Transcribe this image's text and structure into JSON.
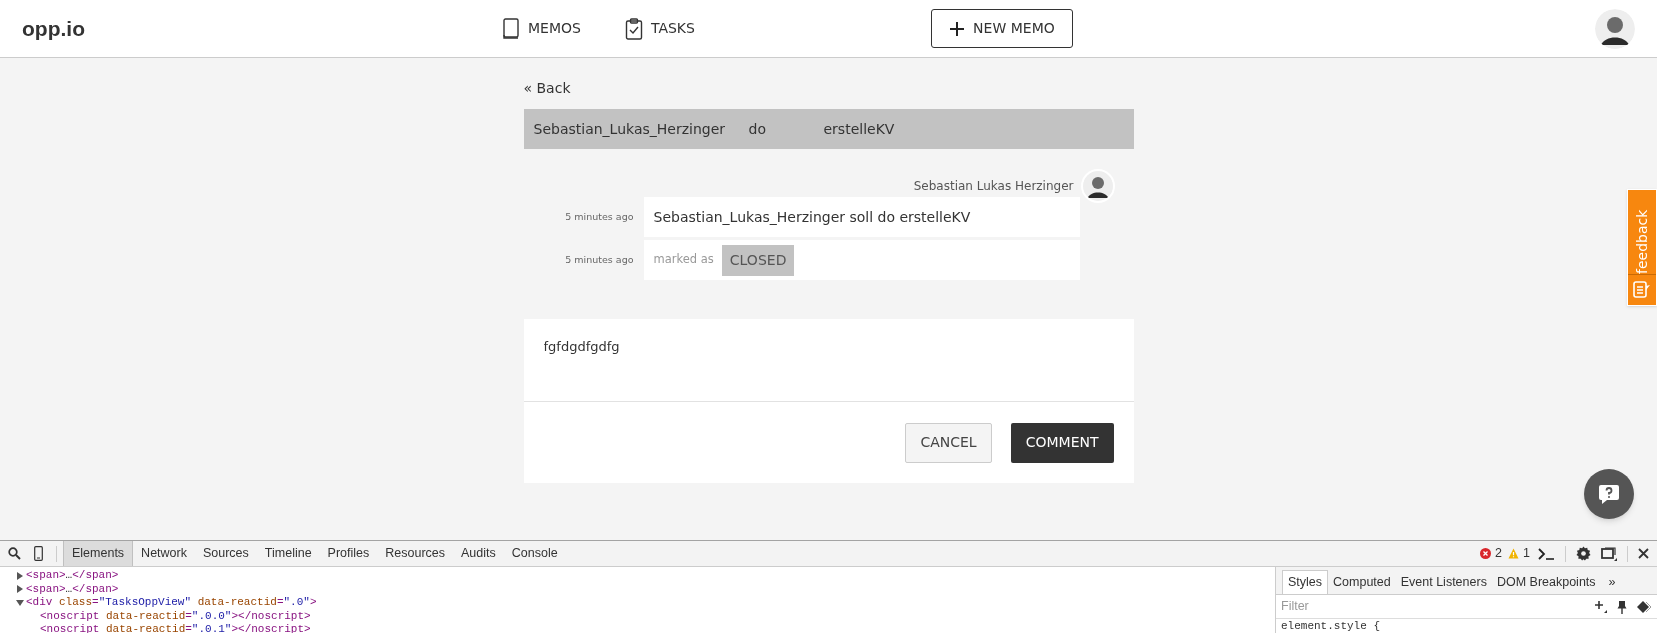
{
  "header": {
    "logo": "opp.io",
    "nav": [
      {
        "label": "MEMOS"
      },
      {
        "label": "TASKS"
      }
    ],
    "new_button": "NEW MEMO"
  },
  "back_link": "« Back",
  "task_bar": {
    "columns": [
      "Sebastian_Lukas_Herzinger",
      "do",
      "erstelleKV"
    ]
  },
  "activity": {
    "author": "Sebastian Lukas Herzinger",
    "entries": [
      {
        "kind": "message",
        "time": "5 minutes ago",
        "text": "Sebastian_Lukas_Herzinger soll do erstelleKV"
      },
      {
        "kind": "status",
        "time": "5 minutes ago",
        "prefix": "marked as",
        "status": "CLOSED"
      }
    ]
  },
  "comment": {
    "value": "fgfdgdfgdfg",
    "buttons": [
      {
        "label": "CANCEL",
        "kind": "secondary"
      },
      {
        "label": "COMMENT",
        "kind": "primary"
      }
    ]
  },
  "feedback_tab": "feedback",
  "devtools": {
    "tabs": [
      {
        "label": "Elements",
        "selected": true
      },
      {
        "label": "Network",
        "selected": false
      },
      {
        "label": "Sources",
        "selected": false
      },
      {
        "label": "Timeline",
        "selected": false
      },
      {
        "label": "Profiles",
        "selected": false
      },
      {
        "label": "Resources",
        "selected": false
      },
      {
        "label": "Audits",
        "selected": false
      },
      {
        "label": "Console",
        "selected": false
      }
    ],
    "errors": "2",
    "warnings": "1",
    "dom_tree": [
      {
        "expanded": false,
        "segments": [
          {
            "kind": "tag",
            "text": "<span>"
          },
          {
            "kind": "text",
            "text": "…"
          },
          {
            "kind": "tag",
            "text": "</span>"
          }
        ]
      },
      {
        "expanded": false,
        "segments": [
          {
            "kind": "tag",
            "text": "<span>"
          },
          {
            "kind": "text",
            "text": "…"
          },
          {
            "kind": "tag",
            "text": "</span>"
          }
        ]
      },
      {
        "expanded": true,
        "segments": [
          {
            "kind": "tag",
            "text": "<div "
          },
          {
            "kind": "attr",
            "text": "class"
          },
          {
            "kind": "tag",
            "text": "="
          },
          {
            "kind": "value",
            "text": "\"TasksOppView\""
          },
          {
            "kind": "attr",
            "text": " data-reactid"
          },
          {
            "kind": "tag",
            "text": "="
          },
          {
            "kind": "value",
            "text": "\".0\""
          },
          {
            "kind": "tag",
            "text": ">"
          }
        ],
        "children": [
          {
            "segments": [
              {
                "kind": "tag",
                "text": "<noscript "
              },
              {
                "kind": "attr",
                "text": "data-reactid"
              },
              {
                "kind": "tag",
                "text": "="
              },
              {
                "kind": "value",
                "text": "\".0.0\""
              },
              {
                "kind": "tag",
                "text": "></noscript>"
              }
            ]
          },
          {
            "segments": [
              {
                "kind": "tag",
                "text": "<noscript "
              },
              {
                "kind": "attr",
                "text": "data-reactid"
              },
              {
                "kind": "tag",
                "text": "="
              },
              {
                "kind": "value",
                "text": "\".0.1\""
              },
              {
                "kind": "tag",
                "text": "></noscript>"
              }
            ]
          }
        ]
      }
    ],
    "sidebar_tabs": [
      {
        "label": "Styles",
        "selected": true
      },
      {
        "label": "Computed",
        "selected": false
      },
      {
        "label": "Event Listeners",
        "selected": false
      },
      {
        "label": "DOM Breakpoints",
        "selected": false
      }
    ],
    "more_tabs": "»",
    "filter_placeholder": "Filter",
    "style_rule": "element.style {"
  }
}
